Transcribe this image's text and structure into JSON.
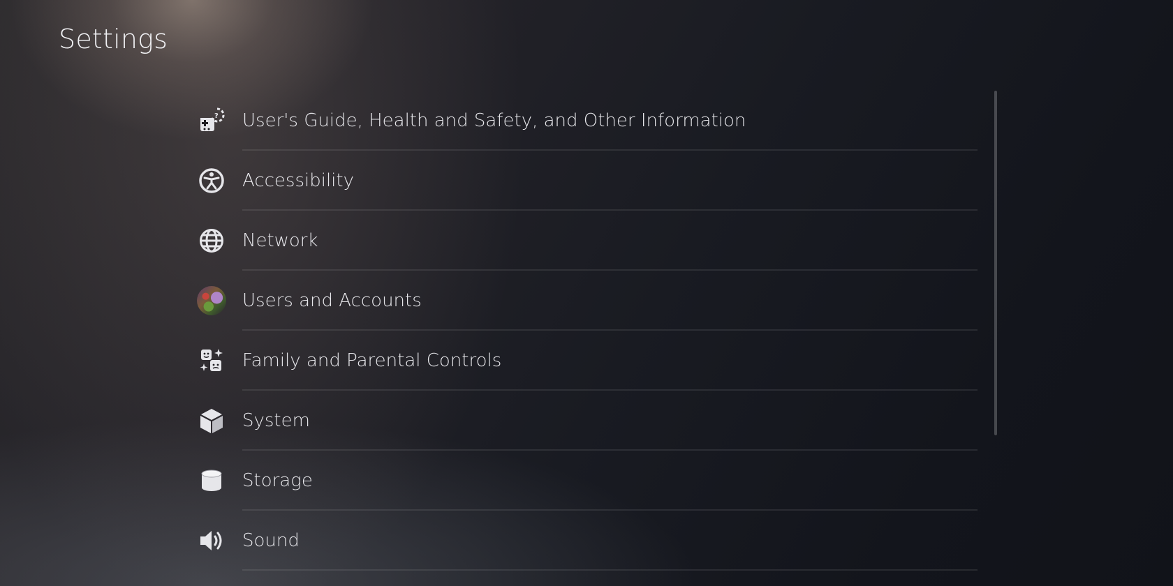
{
  "page": {
    "title": "Settings"
  },
  "settings": {
    "items": [
      {
        "label": "User's Guide, Health and Safety, and Other Information",
        "icon": "users-guide-icon"
      },
      {
        "label": "Accessibility",
        "icon": "accessibility-icon"
      },
      {
        "label": "Network",
        "icon": "globe-icon"
      },
      {
        "label": "Users and Accounts",
        "icon": "user-avatar"
      },
      {
        "label": "Family and Parental Controls",
        "icon": "family-icon"
      },
      {
        "label": "System",
        "icon": "cube-icon"
      },
      {
        "label": "Storage",
        "icon": "storage-cylinder-icon"
      },
      {
        "label": "Sound",
        "icon": "speaker-icon"
      }
    ]
  },
  "colors": {
    "text": "#e6e6ea",
    "background_dark": "#111319",
    "divider": "rgba(255,255,255,0.09)"
  }
}
